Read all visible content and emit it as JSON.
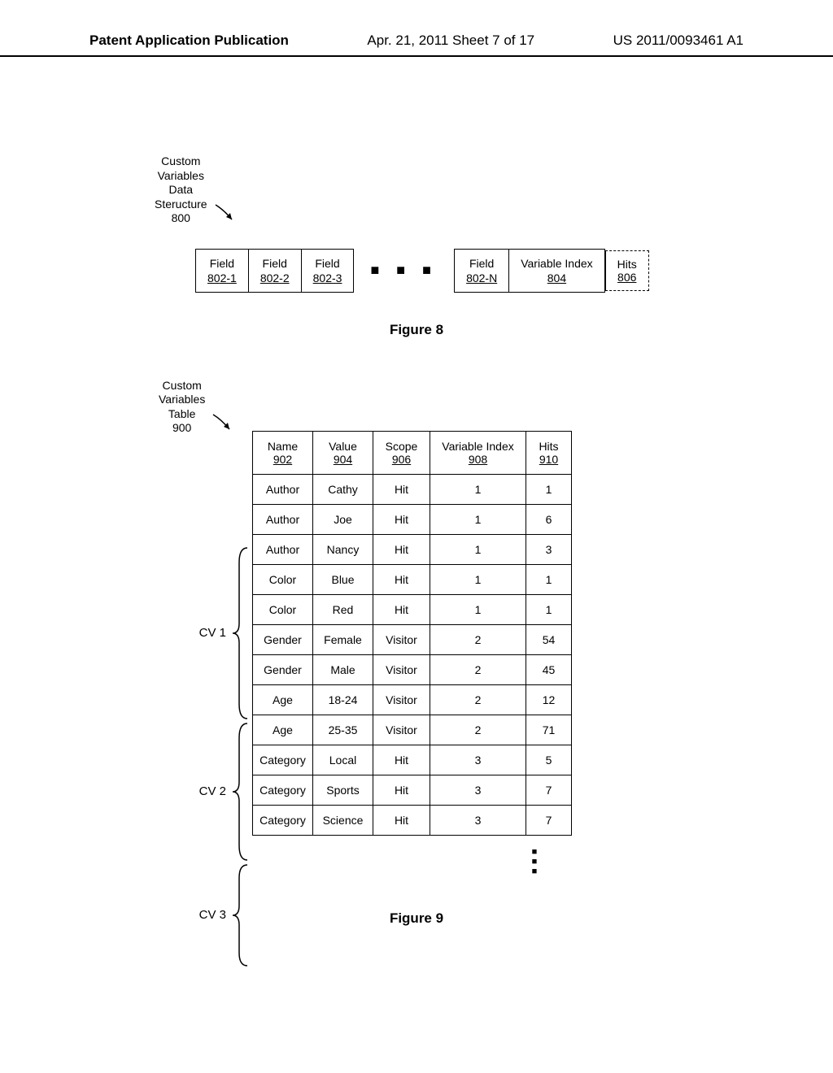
{
  "header": {
    "left": "Patent Application Publication",
    "center": "Apr. 21, 2011 Sheet 7 of 17",
    "right": "US 2011/0093461 A1"
  },
  "fig8": {
    "label": "Custom\nVariables\nData\nSteructure\n800",
    "cells": [
      {
        "top": "Field",
        "bottom": "802-1"
      },
      {
        "top": "Field",
        "bottom": "802-2"
      },
      {
        "top": "Field",
        "bottom": "802-3"
      }
    ],
    "cellN": {
      "top": "Field",
      "bottom": "802-N"
    },
    "varIndex": {
      "top": "Variable Index",
      "bottom": "804"
    },
    "hits": {
      "top": "Hits",
      "bottom": "806"
    },
    "caption": "Figure 8"
  },
  "fig9": {
    "label": "Custom\nVariables\nTable\n900",
    "headers": {
      "name": {
        "top": "Name",
        "bottom": "902"
      },
      "value": {
        "top": "Value",
        "bottom": "904"
      },
      "scope": {
        "top": "Scope",
        "bottom": "906"
      },
      "index": {
        "top": "Variable Index",
        "bottom": "908"
      },
      "hits": {
        "top": "Hits",
        "bottom": "910"
      }
    },
    "groups": [
      {
        "label": "CV 1",
        "rows": 5
      },
      {
        "label": "CV 2",
        "rows": 4
      },
      {
        "label": "CV 3",
        "rows": 3
      }
    ],
    "rows": [
      {
        "name": "Author",
        "value": "Cathy",
        "scope": "Hit",
        "index": "1",
        "hits": "1"
      },
      {
        "name": "Author",
        "value": "Joe",
        "scope": "Hit",
        "index": "1",
        "hits": "6"
      },
      {
        "name": "Author",
        "value": "Nancy",
        "scope": "Hit",
        "index": "1",
        "hits": "3"
      },
      {
        "name": "Color",
        "value": "Blue",
        "scope": "Hit",
        "index": "1",
        "hits": "1"
      },
      {
        "name": "Color",
        "value": "Red",
        "scope": "Hit",
        "index": "1",
        "hits": "1"
      },
      {
        "name": "Gender",
        "value": "Female",
        "scope": "Visitor",
        "index": "2",
        "hits": "54"
      },
      {
        "name": "Gender",
        "value": "Male",
        "scope": "Visitor",
        "index": "2",
        "hits": "45"
      },
      {
        "name": "Age",
        "value": "18-24",
        "scope": "Visitor",
        "index": "2",
        "hits": "12"
      },
      {
        "name": "Age",
        "value": "25-35",
        "scope": "Visitor",
        "index": "2",
        "hits": "71"
      },
      {
        "name": "Category",
        "value": "Local",
        "scope": "Hit",
        "index": "3",
        "hits": "5"
      },
      {
        "name": "Category",
        "value": "Sports",
        "scope": "Hit",
        "index": "3",
        "hits": "7"
      },
      {
        "name": "Category",
        "value": "Science",
        "scope": "Hit",
        "index": "3",
        "hits": "7"
      }
    ],
    "caption": "Figure 9"
  }
}
